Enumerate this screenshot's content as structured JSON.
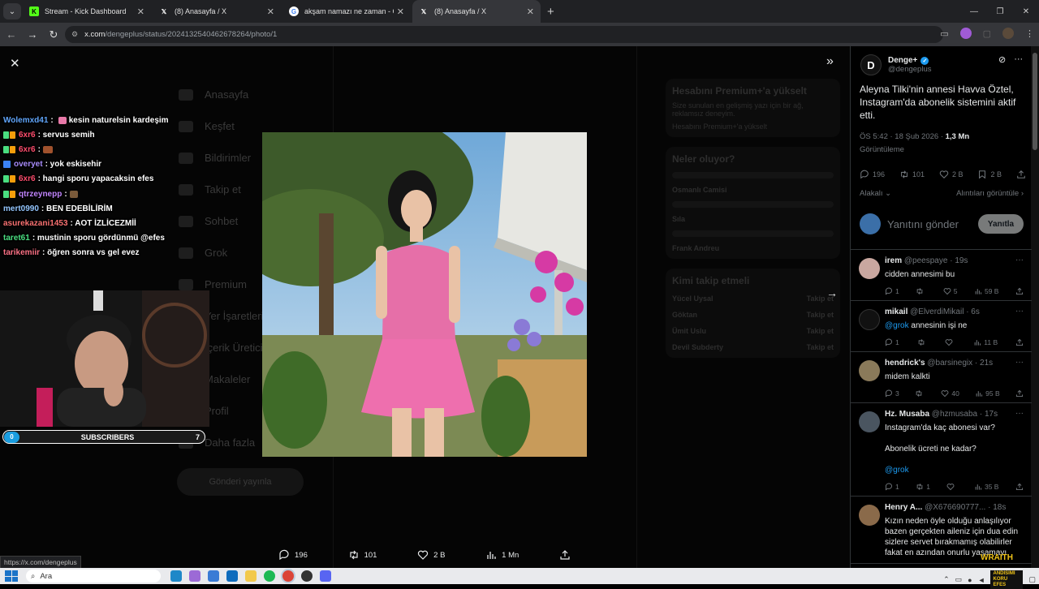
{
  "browser": {
    "tabs": [
      {
        "label": "Stream - Kick Dashboard",
        "icon": "kick-icon",
        "active": false
      },
      {
        "label": "(8) Anasayfa / X",
        "icon": "x-logo-icon",
        "active": false
      },
      {
        "label": "akşam namazı ne zaman - Goo...",
        "icon": "google-icon",
        "active": false
      },
      {
        "label": "(8) Anasayfa / X",
        "icon": "x-logo-icon",
        "active": true
      }
    ],
    "url_host": "x.com",
    "url_path": "/dengeplus/status/2024132540462678264/photo/1",
    "status_url": "https://x.com/dengeplus"
  },
  "background": {
    "nav_items": [
      "Anasayfa",
      "Keşfet",
      "Bildirimler",
      "Takip et",
      "Sohbet",
      "Grok",
      "Premium",
      "Yer İşaretleri",
      "İçerik Üretici",
      "Makaleler",
      "Profil",
      "Daha fazla"
    ],
    "post_button": "Gönderi yayınla",
    "premium_title": "Hesabını Premium+'a yükselt",
    "premium_body": "Size sunulan en gelişmiş yazı için bir ağ, reklamsız deneyim.",
    "premium_cta": "Hesabını Premium+'a yükselt",
    "trends_title": "Neler oluyor?",
    "trends": [
      "Osmanlı Camisi",
      "Sıla",
      "Frank Andreu"
    ],
    "follow_title": "Kimi takip etmeli",
    "follow_names": [
      "Yücel Uysal",
      "Göktan",
      "Ümit Uslu",
      "Devil Subderty"
    ],
    "follow_btn": "Takip et"
  },
  "viewer": {
    "actions": {
      "replies": "196",
      "reposts": "101",
      "likes": "2 B",
      "views": "1 Mn"
    }
  },
  "stream": {
    "chat": [
      {
        "user": "Wolemxd41",
        "color": "#60a5fa",
        "badge": "",
        "text": " kesin  naturelsin  kardeşim "
      },
      {
        "user": "6xr6",
        "color": "#ff4d6d",
        "badge": "sub",
        "text": ": servus semih"
      },
      {
        "user": "6xr6",
        "color": "#ff4d6d",
        "badge": "sub",
        "text": ":"
      },
      {
        "user": "overyet",
        "color": "#a78bfa",
        "badge": "blue",
        "text": ": yok eskisehir"
      },
      {
        "user": "6xr6",
        "color": "#ff4d6d",
        "badge": "sub",
        "text": ": hangi sporu yapacaksin efes"
      },
      {
        "user": "qtrzeynepp",
        "color": "#c084fc",
        "badge": "sub",
        "text": ":"
      },
      {
        "user": "mert0990",
        "color": "#93c5fd",
        "badge": "",
        "text": ": BEN EDEBİLİRİM"
      },
      {
        "user": "asurekazani1453",
        "color": "#f87171",
        "badge": "",
        "text": ": AOT İZLİCEZMİİ"
      },
      {
        "user": "taret61",
        "color": "#4ade80",
        "badge": "",
        "text": ": mustinin sporu gördünmü @efes"
      },
      {
        "user": "tarikemiir",
        "color": "#fb7185",
        "badge": "",
        "text": ": öğren sonra vs gel evez"
      }
    ],
    "subs_label": "SUBSCRIBERS",
    "subs_current": "0",
    "subs_goal": "7",
    "overlay_brand": "WRAITH"
  },
  "tweet": {
    "author_name": "Denge+",
    "author_handle": "@dengeplus",
    "text": "Aleyna Tilki'nin annesi Havva Öztel, Instagram'da abonelik sistemini aktif etti.",
    "time": "ÖS 5:42 · 18 Şub 2026 · ",
    "views_value": "1,3 Mn",
    "views_label": "Görüntüleme",
    "stats": {
      "replies": "196",
      "reposts": "101",
      "likes": "2 B",
      "bookmarks": "2 B"
    },
    "filter_left": "Alakalı",
    "filter_right": "Alıntıları görüntüle",
    "reply_placeholder": "Yanıtını gönder",
    "reply_button": "Yanıtla"
  },
  "replies": [
    {
      "name": "irem",
      "handle": "@peespaye · 19s",
      "text": "cidden annesimi bu",
      "mention": "",
      "extra": "",
      "reply": "1",
      "repost": "",
      "like": "5",
      "views": "59 B",
      "avatar_color": "#c9a7a0"
    },
    {
      "name": "mikail",
      "handle": "@ElverdiMikail · 6s",
      "text": "annesinin işi ne",
      "mention": "@grok",
      "extra": "",
      "reply": "1",
      "repost": "",
      "like": "",
      "views": "11 B",
      "avatar_color": "#111111"
    },
    {
      "name": "hendrick's",
      "handle": "@barsinegix · 21s",
      "text": "midem kalkti",
      "mention": "",
      "extra": "",
      "reply": "3",
      "repost": "",
      "like": "40",
      "views": "95 B",
      "avatar_color": "#8a7a5a"
    },
    {
      "name": "Hz. Musaba",
      "handle": "@hzmusaba · 17s",
      "text": "Instagram'da kaç abonesi var?",
      "mention": "@grok",
      "extra": "Abonelik ücreti ne kadar?",
      "reply": "1",
      "repost": "1",
      "like": "",
      "views": "35 B",
      "avatar_color": "#4a5560"
    },
    {
      "name": "Henry A...",
      "handle": "@X676690777... · 18s",
      "text": "Kızın neden öyle olduğu anlaşılıyor bazen gerçekten aileniz için dua edin sizlere servet bırakmamış olabilirler fakat en azından onurlu yaşamayı",
      "mention": "",
      "extra": "",
      "reply": "",
      "repost": "",
      "like": "",
      "views": "",
      "avatar_color": "#8a6a4a"
    }
  ],
  "taskbar": {
    "search_placeholder": "Ara",
    "tray_brand": "ANDISIMI KORU EFES"
  }
}
